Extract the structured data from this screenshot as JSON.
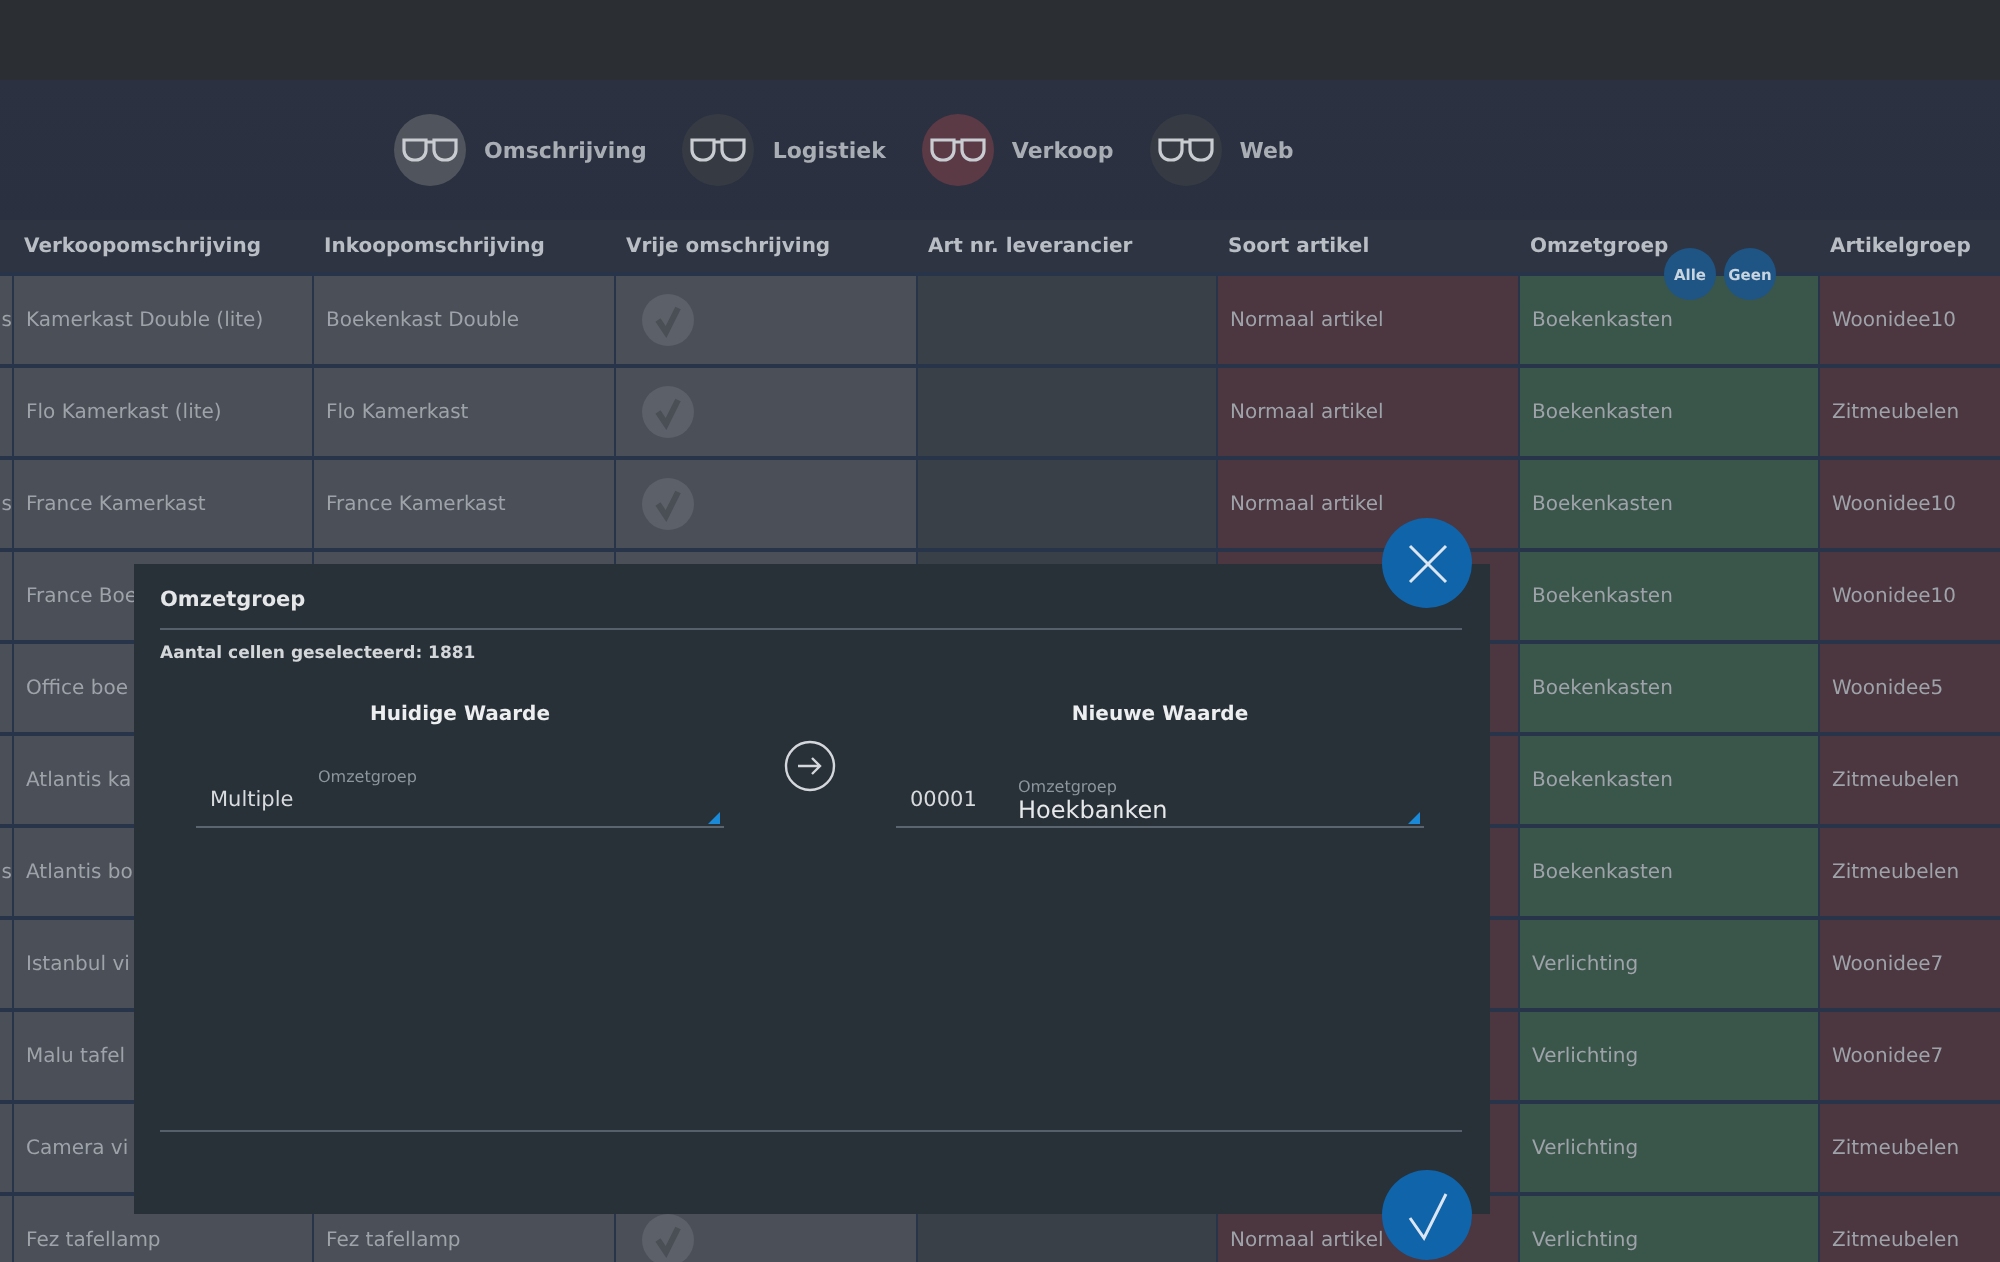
{
  "view_tabs": [
    {
      "label": "Omschrijving",
      "color": "#50545c"
    },
    {
      "label": "Logistiek",
      "color": "#363b43"
    },
    {
      "label": "Verkoop",
      "color": "#5b3a46"
    },
    {
      "label": "Web",
      "color": "#363b43"
    }
  ],
  "table": {
    "columns": [
      {
        "color": "#4a4f58"
      },
      {
        "title": "Verkoopomschrijving",
        "color": "#4a4f58"
      },
      {
        "title": "Inkoopomschrijving",
        "color": "#4a4f58"
      },
      {
        "title": "Vrije omschrijving",
        "color": "#4a4f58"
      },
      {
        "title": "Art nr. leverancier",
        "color": "#3a4047"
      },
      {
        "title": "Soort artikel",
        "color": "#4c3640"
      },
      {
        "title": "Omzetgroep",
        "color": "#3a5549",
        "kind": "filter"
      },
      {
        "title": "Artikelgroep",
        "color": "#4c3640"
      }
    ],
    "header_buttons": [
      "Alle",
      "Geen"
    ],
    "rows": [
      {
        "cells": [
          {
            "kind": "text",
            "text": "s"
          },
          {
            "kind": "text",
            "text": "Kamerkast Double (lite)"
          },
          {
            "kind": "text",
            "text": "Boekenkast Double"
          },
          {
            "kind": "check",
            "checked": true
          },
          {
            "kind": "blank"
          },
          {
            "kind": "text",
            "text": "Normaal artikel"
          },
          {
            "kind": "text",
            "text": "Boekenkasten"
          },
          {
            "kind": "text",
            "text": "Woonidee10"
          }
        ]
      },
      {
        "cells": [
          {
            "kind": "blank"
          },
          {
            "kind": "text",
            "text": "Flo Kamerkast (lite)"
          },
          {
            "kind": "text",
            "text": "Flo Kamerkast"
          },
          {
            "kind": "check",
            "checked": true
          },
          {
            "kind": "blank"
          },
          {
            "kind": "text",
            "text": "Normaal artikel"
          },
          {
            "kind": "text",
            "text": "Boekenkasten"
          },
          {
            "kind": "text",
            "text": "Zitmeubelen"
          }
        ]
      },
      {
        "cells": [
          {
            "kind": "text",
            "text": "s"
          },
          {
            "kind": "text",
            "text": "France Kamerkast"
          },
          {
            "kind": "text",
            "text": "France Kamerkast"
          },
          {
            "kind": "check",
            "checked": true
          },
          {
            "kind": "blank"
          },
          {
            "kind": "text",
            "text": "Normaal artikel"
          },
          {
            "kind": "text",
            "text": "Boekenkasten"
          },
          {
            "kind": "text",
            "text": "Woonidee10"
          }
        ]
      },
      {
        "cells": [
          {
            "kind": "blank"
          },
          {
            "kind": "text",
            "text": "France Boe"
          },
          {
            "kind": "blank"
          },
          {
            "kind": "blank"
          },
          {
            "kind": "blank"
          },
          {
            "kind": "blank"
          },
          {
            "kind": "text",
            "text": "Boekenkasten"
          },
          {
            "kind": "text",
            "text": "Woonidee10"
          }
        ]
      },
      {
        "cells": [
          {
            "kind": "blank"
          },
          {
            "kind": "text",
            "text": "Office boe"
          },
          {
            "kind": "hidden"
          },
          {
            "kind": "hidden"
          },
          {
            "kind": "hidden"
          },
          {
            "kind": "blank"
          },
          {
            "kind": "text",
            "text": "Boekenkasten"
          },
          {
            "kind": "text",
            "text": "Woonidee5"
          }
        ]
      },
      {
        "cells": [
          {
            "kind": "blank"
          },
          {
            "kind": "text",
            "text": "Atlantis ka"
          },
          {
            "kind": "hidden"
          },
          {
            "kind": "hidden"
          },
          {
            "kind": "hidden"
          },
          {
            "kind": "blank"
          },
          {
            "kind": "text",
            "text": "Boekenkasten"
          },
          {
            "kind": "text",
            "text": "Zitmeubelen"
          }
        ]
      },
      {
        "cells": [
          {
            "kind": "text",
            "text": "s"
          },
          {
            "kind": "text",
            "text": "Atlantis bo"
          },
          {
            "kind": "hidden"
          },
          {
            "kind": "hidden"
          },
          {
            "kind": "hidden"
          },
          {
            "kind": "blank"
          },
          {
            "kind": "text",
            "text": "Boekenkasten"
          },
          {
            "kind": "text",
            "text": "Zitmeubelen"
          }
        ]
      },
      {
        "cells": [
          {
            "kind": "blank"
          },
          {
            "kind": "text",
            "text": "Istanbul vi"
          },
          {
            "kind": "hidden"
          },
          {
            "kind": "hidden"
          },
          {
            "kind": "hidden"
          },
          {
            "kind": "blank"
          },
          {
            "kind": "text",
            "text": "Verlichting"
          },
          {
            "kind": "text",
            "text": "Woonidee7"
          }
        ]
      },
      {
        "cells": [
          {
            "kind": "blank"
          },
          {
            "kind": "text",
            "text": "Malu tafel"
          },
          {
            "kind": "hidden"
          },
          {
            "kind": "hidden"
          },
          {
            "kind": "hidden"
          },
          {
            "kind": "blank"
          },
          {
            "kind": "text",
            "text": "Verlichting"
          },
          {
            "kind": "text",
            "text": "Woonidee7"
          }
        ]
      },
      {
        "cells": [
          {
            "kind": "blank"
          },
          {
            "kind": "text",
            "text": "Camera vi"
          },
          {
            "kind": "hidden"
          },
          {
            "kind": "hidden"
          },
          {
            "kind": "hidden"
          },
          {
            "kind": "blank"
          },
          {
            "kind": "text",
            "text": "Verlichting"
          },
          {
            "kind": "text",
            "text": "Zitmeubelen"
          }
        ]
      },
      {
        "cells": [
          {
            "kind": "blank"
          },
          {
            "kind": "text",
            "text": "Fez tafellamp"
          },
          {
            "kind": "text",
            "text": "Fez tafellamp"
          },
          {
            "kind": "check",
            "checked": true
          },
          {
            "kind": "blank"
          },
          {
            "kind": "text",
            "text": "Normaal artikel"
          },
          {
            "kind": "text",
            "text": "Verlichting"
          },
          {
            "kind": "text",
            "text": "Zitmeubelen"
          }
        ]
      }
    ]
  },
  "dialog": {
    "title": "Omzetgroep",
    "info": "Aantal cellen geselecteerd: 1881",
    "current": {
      "heading": "Huidige Waarde",
      "prefix": "Multiple",
      "label": "Omzetgroep"
    },
    "new": {
      "heading": "Nieuwe Waarde",
      "prefix": "00001",
      "label": "Omzetgroep",
      "value": "Hoekbanken"
    }
  }
}
